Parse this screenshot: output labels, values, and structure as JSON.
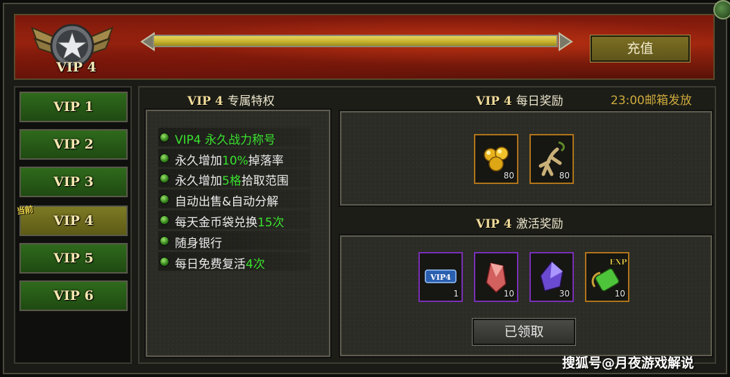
{
  "header": {
    "vip_badge_label": "VIP 4",
    "progress_fraction": 1.0,
    "recharge_label": "充值"
  },
  "sidebar": {
    "current_tag": "当前",
    "items": [
      {
        "label": "VIP 1",
        "active": false
      },
      {
        "label": "VIP 2",
        "active": false
      },
      {
        "label": "VIP 3",
        "active": false
      },
      {
        "label": "VIP 4",
        "active": true
      },
      {
        "label": "VIP 5",
        "active": false
      },
      {
        "label": "VIP 6",
        "active": false
      }
    ]
  },
  "privileges": {
    "level": "VIP 4",
    "title": "专属特权",
    "items": [
      {
        "pre": "",
        "hl": "VIP4 永久战力称号",
        "post": ""
      },
      {
        "pre": "永久增加",
        "hl": "10%",
        "post": "掉落率"
      },
      {
        "pre": "永久增加",
        "hl": "5格",
        "post": "拾取范围"
      },
      {
        "pre": "自动出售&自动分解",
        "hl": "",
        "post": ""
      },
      {
        "pre": "每天金币袋兑换",
        "hl": "15次",
        "post": ""
      },
      {
        "pre": "随身银行",
        "hl": "",
        "post": ""
      },
      {
        "pre": "每日免费复活",
        "hl": "4次",
        "post": ""
      }
    ]
  },
  "daily_rewards": {
    "level": "VIP 4",
    "title": "每日奖励",
    "note": "23:00邮箱发放",
    "items": [
      {
        "icon": "gold-beans-icon",
        "qty": "80"
      },
      {
        "icon": "ginseng-root-icon",
        "qty": "80"
      }
    ]
  },
  "activation_rewards": {
    "level": "VIP 4",
    "title": "激活奖励",
    "items": [
      {
        "icon": "vip4-card-icon",
        "qty": "1",
        "card_text": "VIP4"
      },
      {
        "icon": "red-crystal-icon",
        "qty": "10"
      },
      {
        "icon": "purple-crystal-icon",
        "qty": "30"
      },
      {
        "icon": "exp-potion-icon",
        "qty": "10",
        "badge_text": "EXP"
      }
    ],
    "claimed_label": "已领取"
  },
  "watermark": "搜狐号@月夜游戏解说",
  "colors": {
    "highlight_green": "#39e22e",
    "active_vip": "#7d7a24",
    "vip_button": "#2f6a1c",
    "note_gold": "#cdaa3c"
  }
}
